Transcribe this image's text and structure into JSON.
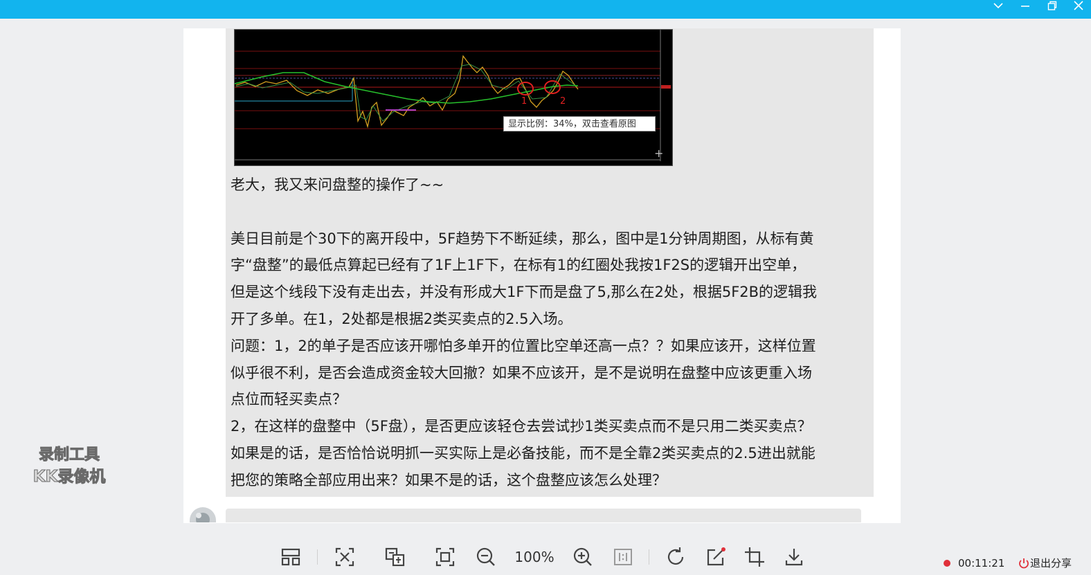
{
  "window": {
    "controls": [
      "chevron-down",
      "minimize",
      "restore",
      "close"
    ]
  },
  "chart_preview": {
    "tooltip": "显示比例：34%，双击查看原图",
    "annotations": [
      "1",
      "2"
    ]
  },
  "message": {
    "lines": [
      "老大，我又来问盘整的操作了~~",
      "",
      "美日目前是个30下的离开段中，5F趋势下不断延续，那么，图中是1分钟周期图，从标有黄",
      "字“盘整”的最低点算起已经有了1F上1F下，在标有1的红圈处我按1F2S的逻辑开出空单，",
      "但是这个线段下没有走出去，并没有形成大1F下而是盘了5,那么在2处，根据5F2B的逻辑我",
      "开了多单。在1，2处都是根据2类买卖点的2.5入场。",
      "问题：1，2的单子是否应该开哪怕多单开的位置比空单还高一点？？如果应该开，这样位置",
      "似乎很不利，是否会造成资金较大回撤？如果不应该开，是不是说明在盘整中应该更重入场",
      "点位而轻买卖点？",
      "2，在这样的盘整中（5F盘），是否更应该轻仓去尝试抄1类买卖点而不是只用二类买卖点？",
      "如果是的话，是否恰恰说明抓一买实际上是必备技能，而不是全靠2类买卖点的2.5进出就能",
      "把您的策略全部应用出来？如果不是的话，这个盘整应该怎么处理？"
    ]
  },
  "watermark": {
    "line1": "录制工具",
    "line2": "KK录像机"
  },
  "toolbar": {
    "icons": [
      "layout-icon",
      "ocr-icon",
      "translate-icon",
      "fit-window-icon",
      "zoom-out-icon",
      "zoom-in-icon",
      "actual-size-icon",
      "rotate-icon",
      "edit-icon",
      "crop-icon",
      "download-icon"
    ],
    "zoom_level": "100%"
  },
  "recording": {
    "timer": "00:11:21",
    "exit_label": "退出分享",
    "accent": "#e0303a"
  },
  "colors": {
    "titlebar": "#12b4ee"
  }
}
